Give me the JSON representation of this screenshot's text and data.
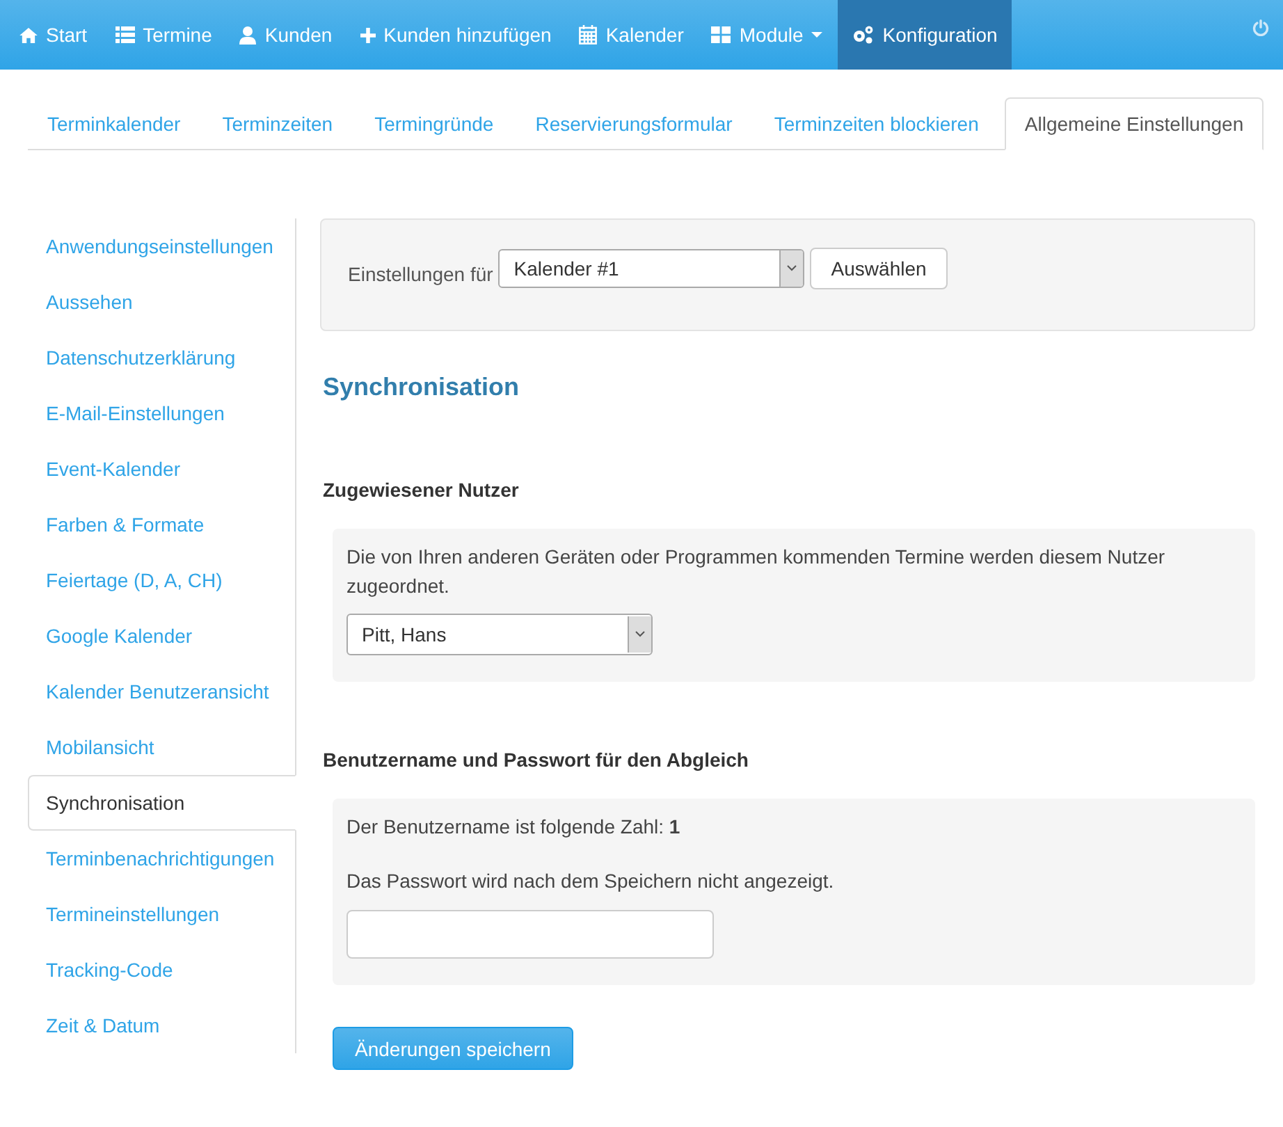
{
  "navbar": {
    "items": [
      {
        "label": "Start",
        "kind": "home",
        "selected": false,
        "dropdown": false
      },
      {
        "label": "Termine",
        "kind": "list",
        "selected": false,
        "dropdown": false
      },
      {
        "label": "Kunden",
        "kind": "user",
        "selected": false,
        "dropdown": false
      },
      {
        "label": "Kunden hinzufügen",
        "kind": "plus",
        "selected": false,
        "dropdown": false
      },
      {
        "label": "Kalender",
        "kind": "calendar",
        "selected": false,
        "dropdown": false
      },
      {
        "label": "Module",
        "kind": "grid",
        "selected": false,
        "dropdown": true
      },
      {
        "label": "Konfiguration",
        "kind": "gears",
        "selected": true,
        "dropdown": false
      }
    ]
  },
  "tabs": [
    {
      "label": "Terminkalender",
      "selected": false
    },
    {
      "label": "Terminzeiten",
      "selected": false
    },
    {
      "label": "Termingründe",
      "selected": false
    },
    {
      "label": "Reservierungsformular",
      "selected": false
    },
    {
      "label": "Terminzeiten blockieren",
      "selected": false
    },
    {
      "label": "Allgemeine Einstellungen",
      "selected": true
    }
  ],
  "sidebar": {
    "items": [
      {
        "label": "Anwendungseinstellungen",
        "selected": false
      },
      {
        "label": "Aussehen",
        "selected": false
      },
      {
        "label": "Datenschutzerklärung",
        "selected": false
      },
      {
        "label": "E-Mail-Einstellungen",
        "selected": false
      },
      {
        "label": "Event-Kalender",
        "selected": false
      },
      {
        "label": "Farben & Formate",
        "selected": false
      },
      {
        "label": "Feiertage (D, A, CH)",
        "selected": false
      },
      {
        "label": "Google Kalender",
        "selected": false
      },
      {
        "label": "Kalender Benutzeransicht",
        "selected": false
      },
      {
        "label": "Mobilansicht",
        "selected": false
      },
      {
        "label": "Synchronisation",
        "selected": true
      },
      {
        "label": "Terminbenachrichtigungen",
        "selected": false
      },
      {
        "label": "Termineinstellungen",
        "selected": false
      },
      {
        "label": "Tracking-Code",
        "selected": false
      },
      {
        "label": "Zeit & Datum",
        "selected": false
      }
    ]
  },
  "settings_for": {
    "label": "Einstellungen für",
    "value": "Kalender #1",
    "button": "Auswählen"
  },
  "heading": "Synchronisation",
  "assigned_user": {
    "heading": "Zugewiesener Nutzer",
    "description": "Die von Ihren anderen Geräten oder Programmen kommenden Termine werden diesem Nutzer zugeordnet.",
    "value": "Pitt, Hans"
  },
  "credentials": {
    "heading": "Benutzername und Passwort für den Abgleich",
    "username_text": "Der Benutzername ist folgende Zahl: **1**",
    "password_note": "Das Passwort wird nach dem Speichern nicht angezeigt."
  },
  "save_button": "Änderungen speichern"
}
